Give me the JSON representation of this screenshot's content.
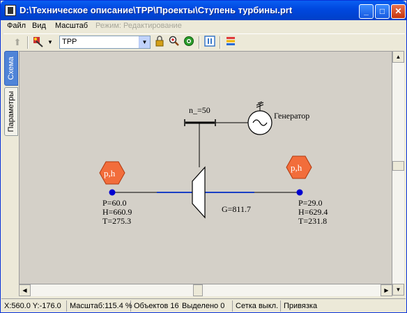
{
  "window": {
    "title": "D:\\Техническое описание\\TPP\\Проекты\\Ступень турбины.prt",
    "minimize": "_",
    "maximize": "□",
    "close": "✕"
  },
  "menu": {
    "items": [
      "Файл",
      "Вид",
      "Масштаб"
    ],
    "mode_label": "Режим: Редактирование"
  },
  "toolbar": {
    "project_select": "TPP"
  },
  "tabs": {
    "scheme": "Схема",
    "params": "Параметры"
  },
  "diagram": {
    "shaft_label": "n_=50",
    "generator_label": "Генератор",
    "flow_label": "G=811.7",
    "node_badge": "p,h",
    "inlet": {
      "P": "P=60.0",
      "H": "H=660.9",
      "T": "T=275.3"
    },
    "outlet": {
      "P": "P=29.0",
      "H": "H=629.4",
      "T": "T=231.8"
    }
  },
  "status": {
    "coords": "X:560.0  Y:-176.0",
    "scale": "Масштаб:115.4 %",
    "objects": "Объектов 16",
    "selected": "Выделено 0",
    "grid": "Сетка выкл.",
    "snap": "Привязка"
  },
  "colors": {
    "titlebar": "#0048e0",
    "canvas_bg": "#d4d0c8",
    "badge_fill": "#f26d3b",
    "node_blue": "#0000d0",
    "pipe_blue": "#1a3fc4"
  }
}
